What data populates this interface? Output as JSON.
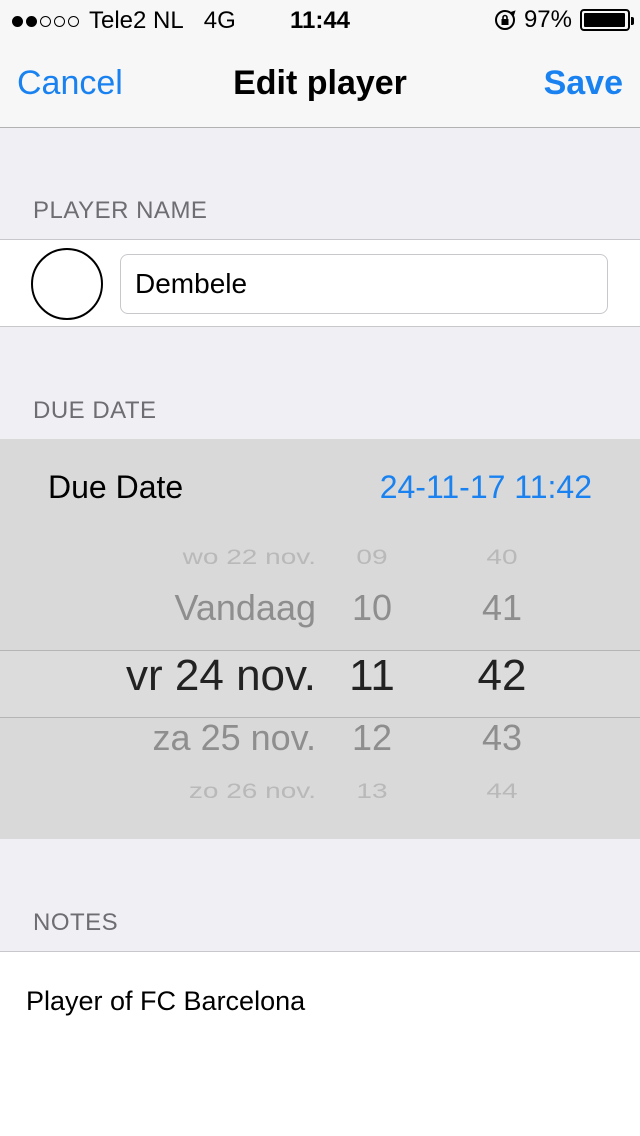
{
  "status_bar": {
    "signal": [
      true,
      true,
      false,
      false,
      false
    ],
    "carrier": "Tele2 NL",
    "network": "4G",
    "time": "11:44",
    "battery": "97%",
    "battery_level": 0.97
  },
  "nav": {
    "cancel_label": "Cancel",
    "title": "Edit player",
    "save_label": "Save"
  },
  "player_section": {
    "header": "PLAYER NAME",
    "name_value": "Dembele"
  },
  "due_date_section": {
    "header": "DUE DATE",
    "row_label": "Due Date",
    "row_value": "24-11-17 11:42",
    "picker": {
      "days": [
        "wo 22 nov.",
        "Vandaag",
        "vr 24 nov.",
        "za 25 nov.",
        "zo 26 nov."
      ],
      "hours": [
        "09",
        "10",
        "11",
        "12",
        "13"
      ],
      "minutes": [
        "40",
        "41",
        "42",
        "43",
        "44"
      ]
    }
  },
  "notes_section": {
    "header": "NOTES",
    "text": "Player of FC Barcelona"
  },
  "colors": {
    "accent": "#1a82f0",
    "background": "#efeff4",
    "picker_background": "#d9d9d9"
  }
}
